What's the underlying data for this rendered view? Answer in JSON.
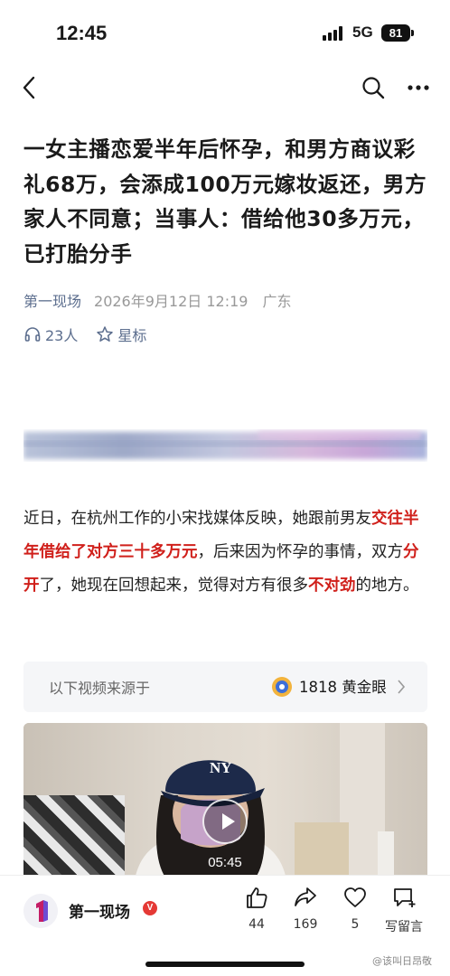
{
  "status_bar": {
    "time": "12:45",
    "network": "5G",
    "battery": "81"
  },
  "article": {
    "title": "一女主播恋爱半年后怀孕，和男方商议彩礼68万，会添成100万元嫁妆返还，男方家人不同意；当事人：借给他30多万元，已打胎分手",
    "source": "第一现场",
    "date": "2026年9月12日 12:19",
    "location": "广东",
    "listeners": "23人",
    "star_label": "星标",
    "body": [
      {
        "text": "近日，在杭州工作的小宋找媒体反映，她跟前男友",
        "highlight": false
      },
      {
        "text": "交往半年借给了对方三十多万元",
        "highlight": true
      },
      {
        "text": "，后来因为怀孕的事情，双方",
        "highlight": false
      },
      {
        "text": "分开",
        "highlight": true
      },
      {
        "text": "了，她现在回想起来，觉得对方有很多",
        "highlight": false
      },
      {
        "text": "不对劲",
        "highlight": true
      },
      {
        "text": "的地方。",
        "highlight": false
      }
    ]
  },
  "video_source": {
    "label": "以下视频来源于",
    "name": "1818 黄金眼"
  },
  "video": {
    "duration": "05:45",
    "cap_logo": "NY"
  },
  "footer": {
    "account": "第一现场",
    "verified": "V",
    "likes": "44",
    "shares": "169",
    "favorites": "5",
    "comment_label": "写留言",
    "watermark": "@该叫日昂敬"
  },
  "colors": {
    "highlight": "#d0201b",
    "link": "#5c6e8e",
    "verified": "#e53935"
  },
  "icons": [
    "back-icon",
    "search-icon",
    "more-icon",
    "headphone-icon",
    "star-icon",
    "play-icon",
    "thumbs-up-icon",
    "share-icon",
    "heart-icon",
    "comment-icon"
  ]
}
